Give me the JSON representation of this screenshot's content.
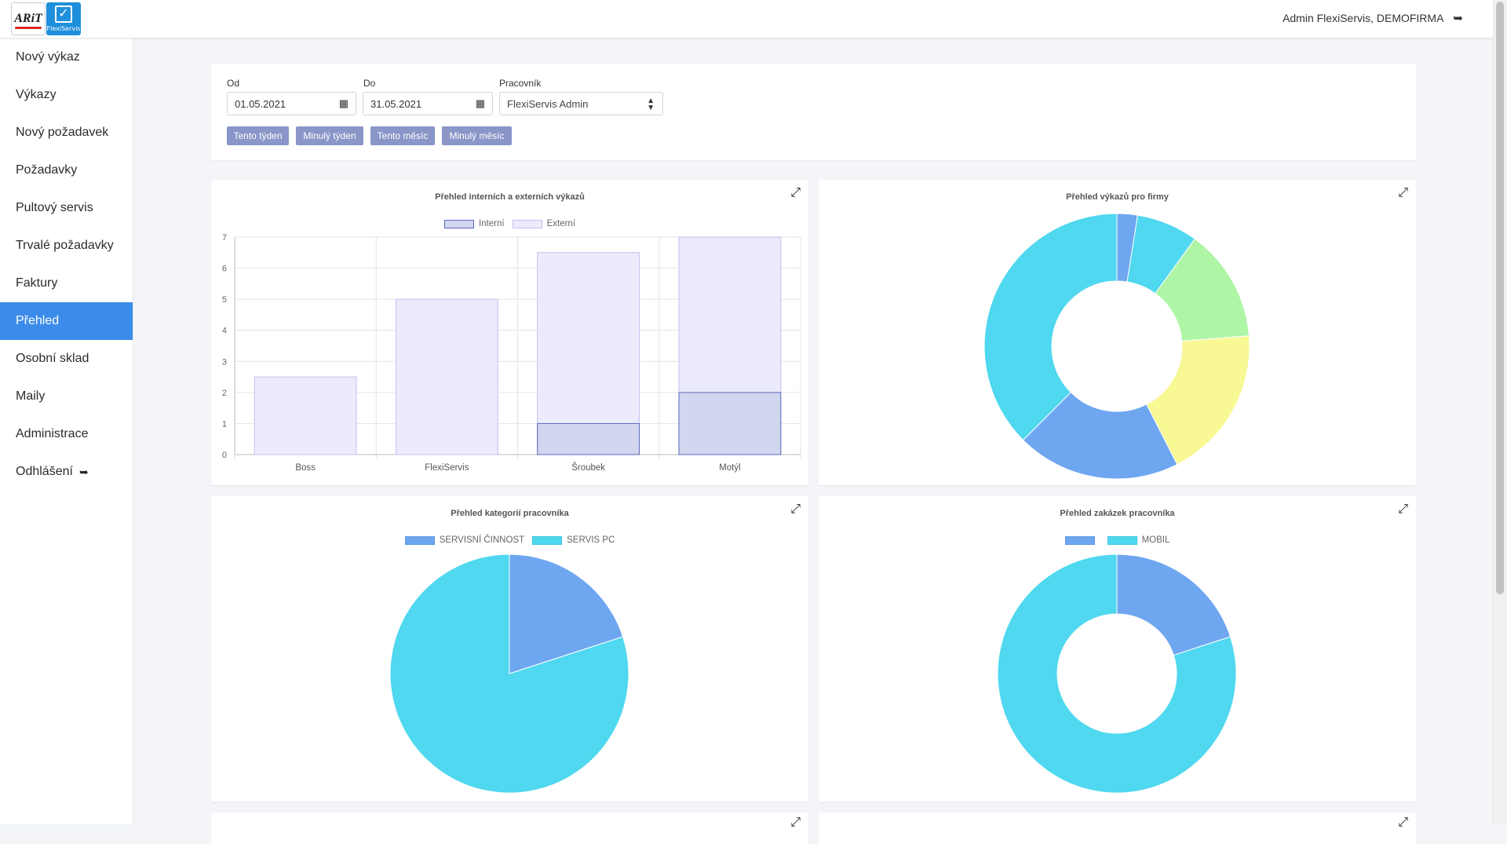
{
  "header": {
    "logo_text": "ARiT",
    "logo_sub": "FlexiServis",
    "user": "Admin FlexiServis, DEMOFIRMA"
  },
  "sidebar": {
    "items": [
      {
        "label": "Nový výkaz"
      },
      {
        "label": "Výkazy"
      },
      {
        "label": "Nový požadavek"
      },
      {
        "label": "Požadavky"
      },
      {
        "label": "Pultový servis"
      },
      {
        "label": "Trvalé požadavky"
      },
      {
        "label": "Faktury"
      },
      {
        "label": "Přehled",
        "active": true
      },
      {
        "label": "Osobní sklad"
      },
      {
        "label": "Maily"
      },
      {
        "label": "Administrace"
      },
      {
        "label": "Odhlášení"
      }
    ]
  },
  "filters": {
    "from_label": "Od",
    "from_value": "01.05.2021",
    "to_label": "Do",
    "to_value": "31.05.2021",
    "worker_label": "Pracovník",
    "worker_value": "FlexiServis Admin",
    "quick": [
      "Tento týden",
      "Minulý týden",
      "Tento měsíc",
      "Minulý měsíc"
    ]
  },
  "colors": {
    "accent": "#3b8bea",
    "quick_button": "#8a95c8",
    "intern_fill": "#d2d6ee",
    "intern_border": "#5d68c0",
    "extern_fill": "#ecebfb",
    "extern_border": "#c4bff0",
    "cyan": "#4fd8ef",
    "blue": "#6ea6f0",
    "green": "#aef5a6",
    "yellow": "#f8f894"
  },
  "chart_data": [
    {
      "type": "bar",
      "title": "Přehled interních a externích výkazů",
      "categories": [
        "Boss",
        "FlexiServis",
        "Šroubek",
        "Motýl"
      ],
      "series": [
        {
          "name": "Interní",
          "values": [
            0,
            0,
            1,
            2
          ]
        },
        {
          "name": "Externí",
          "values": [
            2.5,
            5,
            6.5,
            7
          ]
        }
      ],
      "ylim": [
        0,
        7
      ],
      "yticks": [
        "0",
        "1",
        "2",
        "3",
        "4",
        "5",
        "6",
        "7"
      ],
      "grid": true,
      "legend": "top"
    },
    {
      "type": "pie",
      "title": "Přehled výkazů pro firmy",
      "donut": true,
      "values": [
        1,
        3,
        5.5,
        7.5,
        8,
        15
      ]
    },
    {
      "type": "pie",
      "title": "Přehled kategorií pracovníka",
      "donut": false,
      "labels": [
        "SERVISNÍ ČINNOST",
        "SERVIS PC"
      ],
      "values": [
        20,
        80
      ],
      "legend": "top"
    },
    {
      "type": "pie",
      "title": "Přehled zakázek pracovníka",
      "donut": true,
      "labels": [
        "",
        "MOBIL"
      ],
      "values": [
        20,
        80
      ],
      "legend": "top"
    }
  ]
}
